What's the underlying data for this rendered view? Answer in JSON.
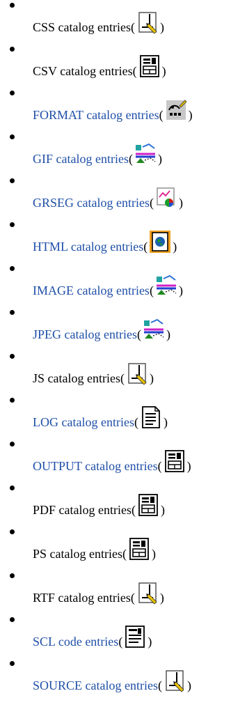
{
  "entries": [
    {
      "text": "CSS catalog entries",
      "link": false,
      "icon": "source-pencil-icon"
    },
    {
      "text": "CSV catalog entries",
      "link": false,
      "icon": "form-document-icon"
    },
    {
      "text": "FORMAT catalog entries",
      "link": true,
      "icon": "format-icon"
    },
    {
      "text": "GIF catalog entries",
      "link": true,
      "icon": "image-icon"
    },
    {
      "text": "GRSEG catalog entries",
      "link": true,
      "icon": "grseg-icon"
    },
    {
      "text": "HTML catalog entries",
      "link": true,
      "icon": "html-globe-icon"
    },
    {
      "text": "IMAGE catalog entries",
      "link": true,
      "icon": "image-icon"
    },
    {
      "text": "JPEG catalog entries",
      "link": true,
      "icon": "image-icon"
    },
    {
      "text": "JS catalog entries",
      "link": false,
      "icon": "source-pencil-icon"
    },
    {
      "text": "LOG catalog entries",
      "link": true,
      "icon": "log-icon"
    },
    {
      "text": "OUTPUT catalog entries",
      "link": true,
      "icon": "form-document-icon"
    },
    {
      "text": "PDF catalog entries",
      "link": false,
      "icon": "form-document-icon"
    },
    {
      "text": "PS catalog entries",
      "link": false,
      "icon": "form-document-icon"
    },
    {
      "text": "RTF catalog entries",
      "link": false,
      "icon": "source-pencil-icon"
    },
    {
      "text": "SCL code entries",
      "link": true,
      "icon": "scl-code-icon"
    },
    {
      "text": "SOURCE catalog entries",
      "link": true,
      "icon": "source-pencil-icon"
    }
  ],
  "paren_open": "(",
  "paren_close": ")",
  "colors": {
    "link": "#1f4fa8",
    "text": "#000000"
  }
}
